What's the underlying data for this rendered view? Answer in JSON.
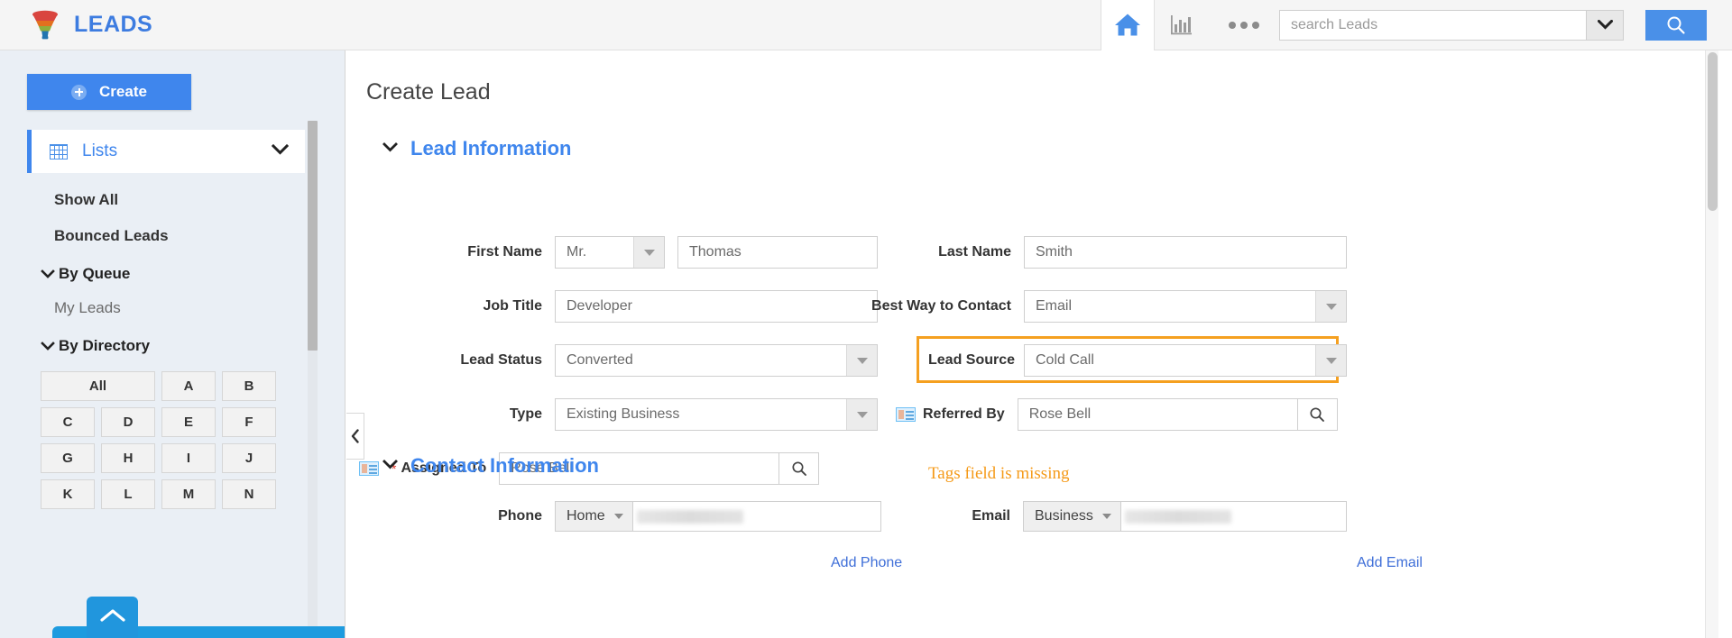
{
  "header": {
    "brand": "LEADS",
    "home_title": "Home",
    "reports_title": "Reports",
    "more_title": "More",
    "search_placeholder": "search Leads",
    "search_value": ""
  },
  "sidebar": {
    "create_label": "Create",
    "lists_label": "Lists",
    "links": [
      {
        "label": "Show All"
      },
      {
        "label": "Bounced Leads"
      }
    ],
    "by_queue_label": "By Queue",
    "my_leads_label": "My Leads",
    "by_directory_label": "By Directory",
    "alpha": [
      "All",
      "A",
      "B",
      "C",
      "D",
      "E",
      "F",
      "G",
      "H",
      "I",
      "J",
      "K",
      "L",
      "M",
      "N"
    ]
  },
  "main": {
    "page_title": "Create Lead",
    "sections": {
      "lead_information": "Lead Information",
      "contact_information": "Contact Information"
    },
    "fields": {
      "first_name_label": "First Name",
      "salutation_value": "Mr.",
      "first_name_value": "Thomas",
      "last_name_label": "Last Name",
      "last_name_value": "Smith",
      "job_title_label": "Job Title",
      "job_title_value": "Developer",
      "best_way_label": "Best Way to Contact",
      "best_way_value": "Email",
      "lead_status_label": "Lead Status",
      "lead_status_value": "Converted",
      "lead_source_label": "Lead Source",
      "lead_source_value": "Cold Call",
      "type_label": "Type",
      "type_value": "Existing Business",
      "referred_by_label": "Referred By",
      "referred_by_value": "Rose Bell",
      "assigned_to_label": "Assigned To",
      "assigned_to_value": "Rose Bell",
      "assigned_to_required": "*",
      "phone_label": "Phone",
      "phone_type_value": "Home",
      "add_phone_label": "Add Phone",
      "email_label": "Email",
      "email_type_value": "Business",
      "add_email_label": "Add Email"
    },
    "notice": {
      "tags_missing": "Tags field is missing"
    }
  },
  "colors": {
    "brand_blue": "#3d7ce0",
    "accent_blue": "#3f86ed",
    "warning_orange": "#f5a020",
    "required_red": "#e03b2f",
    "sidebar_bg": "#eaeff5"
  }
}
